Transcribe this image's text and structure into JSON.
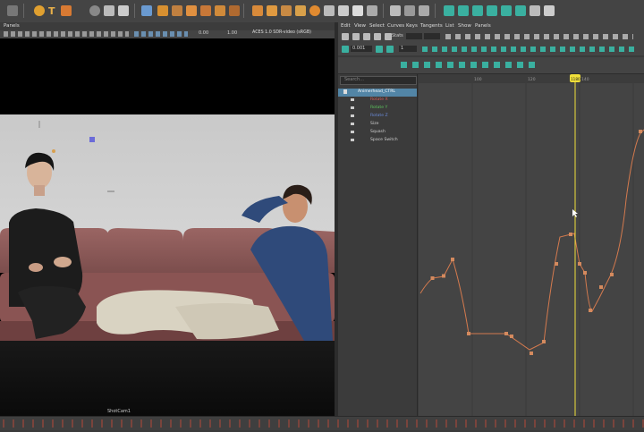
{
  "viewport": {
    "panels_label": "Panels",
    "exposure": "0.00",
    "gamma": "1.00",
    "color_space": "ACES 1.0 SDR-video (sRGB)",
    "camera_name": "ShotCam1"
  },
  "graph_editor": {
    "menu": [
      "Edit",
      "View",
      "Select",
      "Curves",
      "Keys",
      "Tangents",
      "List",
      "Show",
      "Panels"
    ],
    "stats_label": "Stats",
    "frame_value": "0.001",
    "value_field": "1",
    "search_placeholder": "Search...",
    "outliner": {
      "control": "Animerhead_CTRL",
      "channels": [
        "Rotate X",
        "Rotate Y",
        "Rotate Z",
        "Size",
        "Squash",
        "Space Switch"
      ]
    },
    "current_frame": "1180",
    "ruler_ticks": [
      "100",
      "120",
      "140"
    ]
  },
  "colors": {
    "curve": "#d47a4e",
    "current_time": "#f0df3a",
    "selected": "#5285a6"
  }
}
